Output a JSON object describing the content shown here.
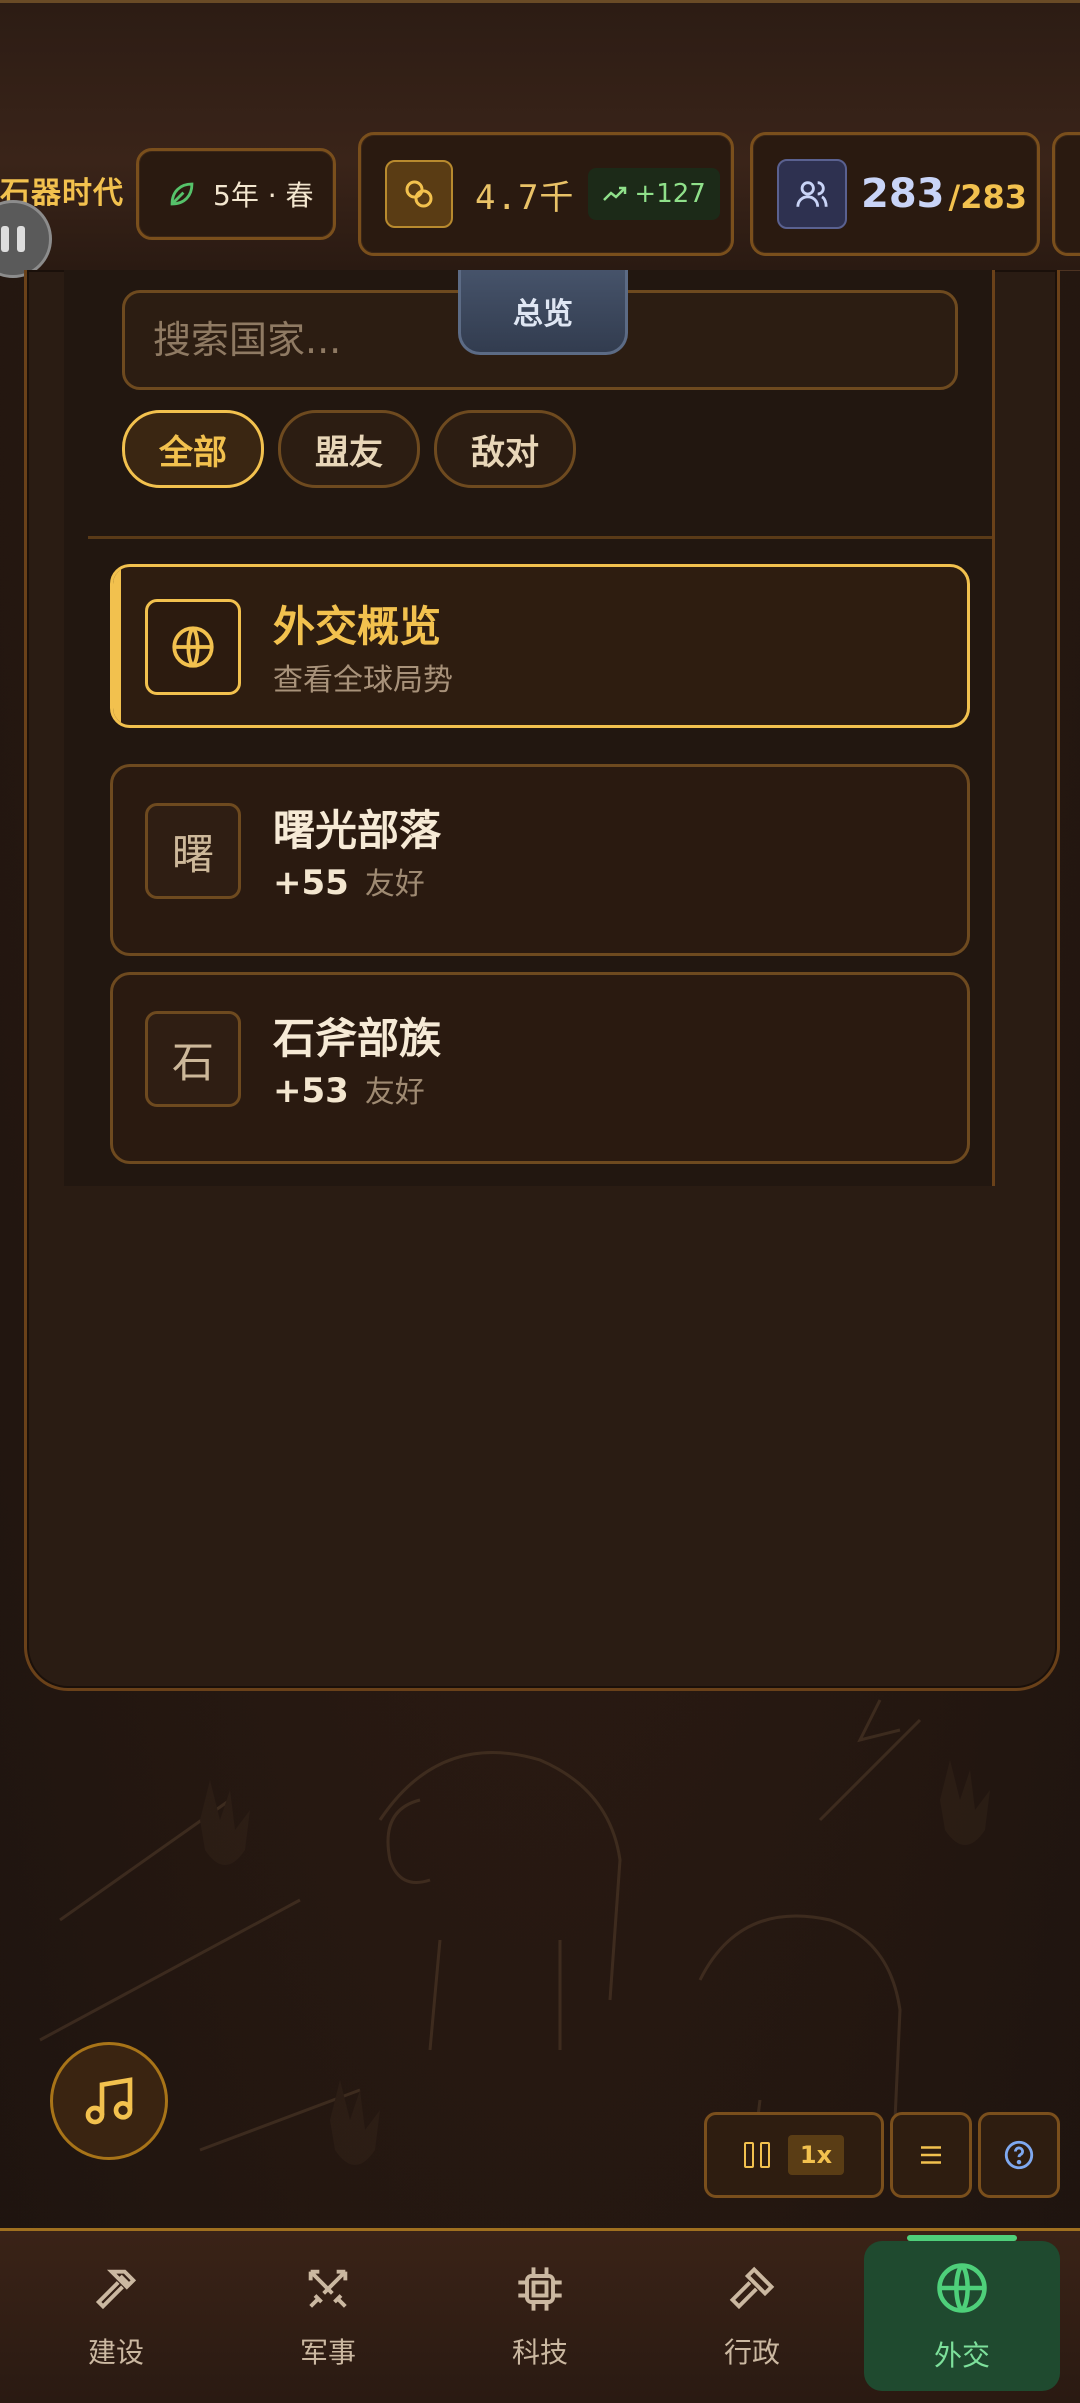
{
  "status_bar": {
    "era": "石器时代",
    "date": "5年 · 春",
    "gold": "4.7千",
    "gold_income": "+127",
    "population_current": "283",
    "population_max": "/283"
  },
  "panel": {
    "search": {
      "placeholder": "搜索国家..."
    },
    "overview_tab": "总览",
    "filters": [
      "全部",
      "盟友",
      "敌对"
    ],
    "active_filter": "全部",
    "items": [
      {
        "icon": "globe-icon",
        "title": "外交概览",
        "subtitle": "查看全球局势",
        "selected": true
      },
      {
        "icon_text": "曙",
        "title": "曙光部落",
        "relation_value": "+55",
        "relation_label": "友好"
      },
      {
        "icon_text": "石",
        "title": "石斧部族",
        "relation_value": "+53",
        "relation_label": "友好"
      }
    ]
  },
  "controls": {
    "speed": "1x"
  },
  "bottom_nav": [
    {
      "label": "建设",
      "icon": "hammer-icon"
    },
    {
      "label": "军事",
      "icon": "swords-icon"
    },
    {
      "label": "科技",
      "icon": "chip-icon"
    },
    {
      "label": "行政",
      "icon": "gavel-icon"
    },
    {
      "label": "外交",
      "icon": "globe-icon",
      "active": true
    }
  ],
  "colors": {
    "accent_gold": "#f2c14e",
    "active_nav_bg": "#1f4a2f",
    "active_nav_text": "#7de09b"
  }
}
